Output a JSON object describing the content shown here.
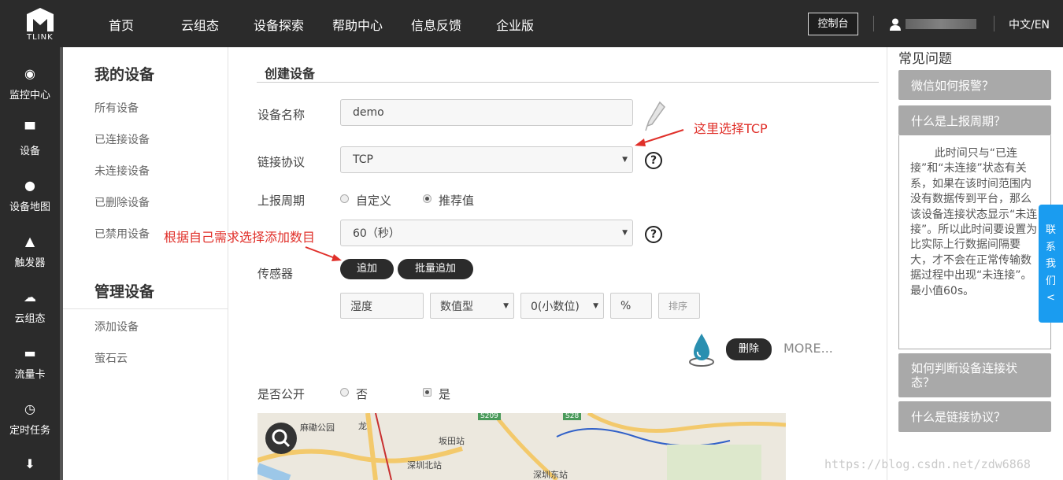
{
  "header": {
    "logo_text": "TLINK",
    "nav": [
      "首页",
      "云组态",
      "设备探索",
      "帮助中心",
      "信息反馈",
      "企业版"
    ],
    "console_label": "控制台",
    "lang_label": "中文/EN"
  },
  "leftbar": {
    "items": [
      {
        "label": "监控中心",
        "icon": "target-icon"
      },
      {
        "label": "设备",
        "icon": "monitor-icon"
      },
      {
        "label": "设备地图",
        "icon": "map-pin-icon"
      },
      {
        "label": "触发器",
        "icon": "bell-icon"
      },
      {
        "label": "云组态",
        "icon": "cloud-icon"
      },
      {
        "label": "流量卡",
        "icon": "card-icon"
      },
      {
        "label": "定时任务",
        "icon": "clock-icon"
      }
    ]
  },
  "subnav": {
    "section1_title": "我的设备",
    "section1_items": [
      "所有设备",
      "已连接设备",
      "未连接设备",
      "已删除设备",
      "已禁用设备"
    ],
    "section2_title": "管理设备",
    "section2_items": [
      "添加设备",
      "萤石云"
    ]
  },
  "form": {
    "title": "创建设备",
    "name_label": "设备名称",
    "name_value": "demo",
    "protocol_label": "链接协议",
    "protocol_value": "TCP",
    "period_label": "上报周期",
    "period_opt_custom": "自定义",
    "period_opt_recommend": "推荐值",
    "period_value": "60（秒）",
    "sensor_label": "传感器",
    "add_label": "追加",
    "batch_add_label": "批量追加",
    "sensor_name": "湿度",
    "sensor_type": "数值型",
    "sensor_decimal": "0(小数位)",
    "sensor_unit": "%",
    "sensor_sort": "排序",
    "delete_label": "删除",
    "more_label": "MORE...",
    "public_label": "是否公开",
    "public_no": "否",
    "public_yes": "是",
    "help_glyph": "?"
  },
  "annotations": {
    "tcp_note": "这里选择TCP",
    "count_note": "根据自己需求选择添加数目"
  },
  "map": {
    "labels": [
      "麻磡公园",
      "坂田站",
      "深圳北站",
      "深圳东站",
      "S209",
      "S28",
      "龙"
    ]
  },
  "faq": {
    "title": "常见问题",
    "q1": "微信如何报警？",
    "q2": "什么是上报周期？",
    "a2": "此时间只与“已连接”和“未连接”状态有关系，如果在该时间范围内没有数据传到平台，那么该设备连接状态显示“未连接”。所以此时间要设置为比实际上行数据间隔要大，才不会在正常传输数据过程中出现“未连接”。最小值60s。",
    "q3": "如何判断设备连接状态？",
    "q4": "什么是链接协议？"
  },
  "contact": {
    "label": "联系我们",
    "arrow": "<"
  },
  "watermark": "https://blog.csdn.net/zdw6868",
  "colors": {
    "dark": "#2b2b2b",
    "faq_btn": "#a9a9a9",
    "contact": "#1a9cf0",
    "annotation": "#e0302a"
  }
}
